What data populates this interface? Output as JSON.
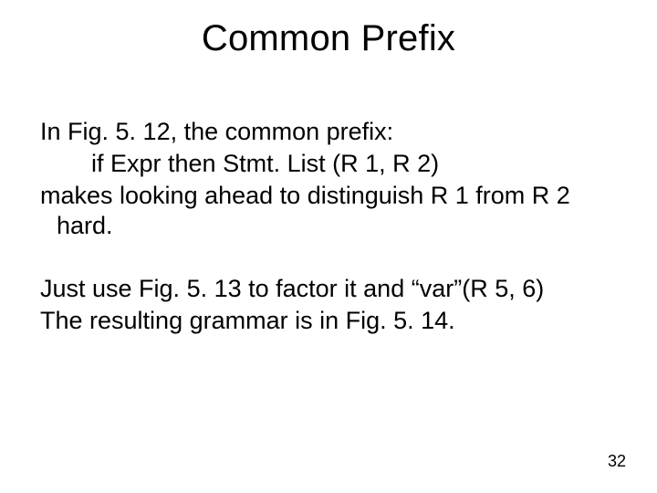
{
  "slide": {
    "title": "Common Prefix",
    "lines": {
      "l1": "In Fig. 5. 12, the common prefix:",
      "l2": "if Expr then Stmt. List (R 1, R 2)",
      "l3": "makes looking ahead to distinguish R 1 from R 2 hard.",
      "l4": "Just use Fig. 5. 13 to factor it and “var”(R 5, 6)",
      "l5": "The resulting grammar is in Fig. 5. 14."
    },
    "page_number": "32"
  }
}
